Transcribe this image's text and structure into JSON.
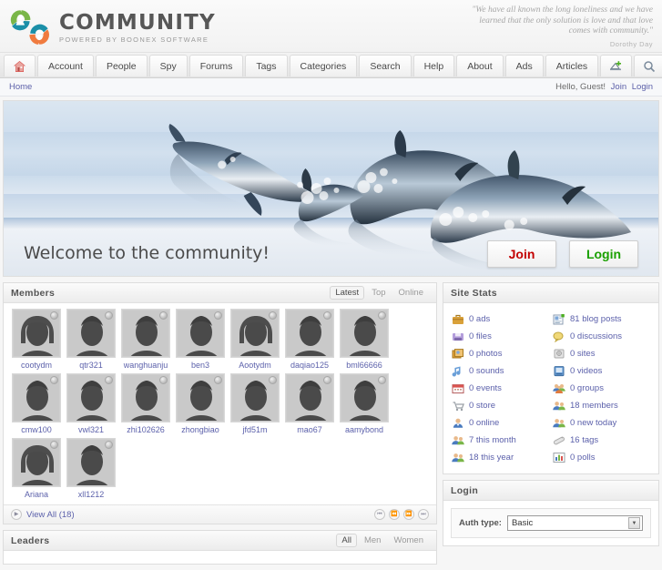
{
  "header": {
    "logo": {
      "title": "COMMUNITY",
      "subtitle": "POWERED BY BOONEX SOFTWARE",
      "colors": {
        "green": "#7ab648",
        "teal": "#1b8fa8",
        "orange": "#f07b3f",
        "title": "#575757"
      }
    },
    "quote": {
      "line1": "\"We have all known the long loneliness and we have",
      "line2": "learned that the only solution is love and that love",
      "line3": "comes with community.\"",
      "author": "Dorothy Day"
    }
  },
  "nav": {
    "items": [
      {
        "label": "",
        "icon": "home-icon"
      },
      {
        "label": "Account",
        "icon": ""
      },
      {
        "label": "People",
        "icon": ""
      },
      {
        "label": "Spy",
        "icon": ""
      },
      {
        "label": "Forums",
        "icon": ""
      },
      {
        "label": "Tags",
        "icon": ""
      },
      {
        "label": "Categories",
        "icon": ""
      },
      {
        "label": "Search",
        "icon": ""
      },
      {
        "label": "Help",
        "icon": ""
      },
      {
        "label": "About",
        "icon": ""
      },
      {
        "label": "Ads",
        "icon": ""
      },
      {
        "label": "Articles",
        "icon": ""
      },
      {
        "label": "",
        "icon": "upload-icon"
      },
      {
        "label": "",
        "icon": "search-icon"
      }
    ]
  },
  "subbar": {
    "breadcrumb": "Home",
    "greeting": "Hello, Guest!",
    "join_label": "Join",
    "login_label": "Login"
  },
  "banner": {
    "welcome": "Welcome to the community!",
    "join_button": "Join",
    "login_button": "Login",
    "join_color": "#c30000",
    "login_color": "#1aa000"
  },
  "members_block": {
    "title": "Members",
    "tabs": [
      {
        "label": "Latest",
        "active": true
      },
      {
        "label": "Top",
        "active": false
      },
      {
        "label": "Online",
        "active": false
      }
    ],
    "members": [
      {
        "name": "cootydm",
        "gender": "female"
      },
      {
        "name": "qtr321",
        "gender": "male"
      },
      {
        "name": "wanghuanju",
        "gender": "male"
      },
      {
        "name": "ben3",
        "gender": "male"
      },
      {
        "name": "Aootydm",
        "gender": "female"
      },
      {
        "name": "daqiao125",
        "gender": "male"
      },
      {
        "name": "bml66666",
        "gender": "male"
      },
      {
        "name": "cmw100",
        "gender": "male"
      },
      {
        "name": "vwl321",
        "gender": "male"
      },
      {
        "name": "zhi102626",
        "gender": "male"
      },
      {
        "name": "zhongbiao",
        "gender": "male"
      },
      {
        "name": "jfd51m",
        "gender": "male"
      },
      {
        "name": "mao67",
        "gender": "male"
      },
      {
        "name": "aamybond",
        "gender": "male"
      },
      {
        "name": "Ariana",
        "gender": "female"
      },
      {
        "name": "xll1212",
        "gender": "male"
      }
    ],
    "view_all": "View All (18)",
    "pager": [
      "first",
      "prev",
      "next",
      "last"
    ]
  },
  "leaders_block": {
    "title": "Leaders",
    "tabs": [
      {
        "label": "All",
        "active": true
      },
      {
        "label": "Men",
        "active": false
      },
      {
        "label": "Women",
        "active": false
      }
    ]
  },
  "stats_block": {
    "title": "Site Stats",
    "left": [
      {
        "label": "0 ads",
        "icon": "briefcase-icon"
      },
      {
        "label": "0 files",
        "icon": "floppy-icon"
      },
      {
        "label": "0 photos",
        "icon": "photos-icon"
      },
      {
        "label": "0 sounds",
        "icon": "music-note-icon"
      },
      {
        "label": "0 events",
        "icon": "calendar-icon"
      },
      {
        "label": "0 store",
        "icon": "cart-icon"
      },
      {
        "label": "0 online",
        "icon": "user-icon"
      },
      {
        "label": "7 this month",
        "icon": "users-icon"
      },
      {
        "label": "18 this year",
        "icon": "users-icon"
      }
    ],
    "right": [
      {
        "label": "81 blog posts",
        "icon": "blog-icon"
      },
      {
        "label": "0 discussions",
        "icon": "speech-icon"
      },
      {
        "label": "0 sites",
        "icon": "sites-icon"
      },
      {
        "label": "0 videos",
        "icon": "video-icon"
      },
      {
        "label": "0 groups",
        "icon": "groups-icon"
      },
      {
        "label": "18 members",
        "icon": "users-icon"
      },
      {
        "label": "0 new today",
        "icon": "users-icon"
      },
      {
        "label": "16 tags",
        "icon": "tag-icon"
      },
      {
        "label": "0 polls",
        "icon": "chart-icon"
      }
    ]
  },
  "login_block": {
    "title": "Login",
    "auth_label": "Auth type:",
    "auth_value": "Basic"
  }
}
